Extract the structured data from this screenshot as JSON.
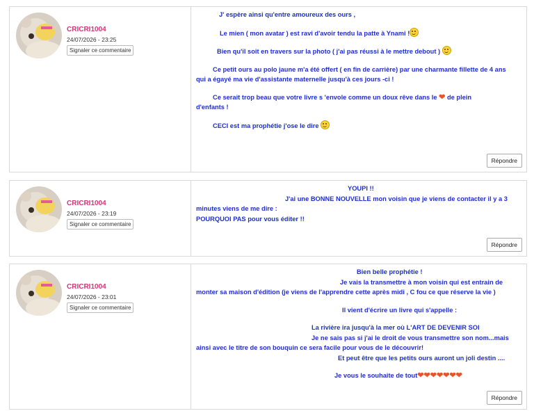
{
  "comments": [
    {
      "username": "CRICRI1004",
      "date": "24/07/2026 - 23:25",
      "report_label": "Signaler ce commentaire",
      "reply_label": "Répondre",
      "lines": [
        "J' espère  ainsi qu'entre amoureux des ours ,",
        "Le mien ( mon avatar ) est ravi d'avoir tendu la patte à Ynami !",
        "Bien qu'il soit en travers sur la photo ( j'ai pas réussi à le mettre debout )",
        "Ce petit ours au polo jaune m'a été offert ( en fin de carrière) par une charmante fillette de 4 ans",
        "qui a égayé ma vie d'assistante maternelle  jusqu'à ces jours -ci !",
        "Ce serait trop beau  que votre livre  s 'envole comme un doux rêve dans le",
        "de plein",
        "d'enfants !",
        "CECI est ma prophétie  j'ose le dire"
      ]
    },
    {
      "username": "CRICRI1004",
      "date": "24/07/2026 - 23:19",
      "report_label": "Signaler ce commentaire",
      "reply_label": "Répondre",
      "lines": [
        "YOUPI !!",
        "J'ai une BONNE NOUVELLE  mon voisin que je viens de contacter il y a 3",
        "minutes viens de me dire :",
        "POURQUOI PAS pour vous éditer !!"
      ]
    },
    {
      "username": "CRICRI1004",
      "date": "24/07/2026 - 23:01",
      "report_label": "Signaler ce commentaire",
      "reply_label": "Répondre",
      "lines": [
        "Bien belle prophétie !",
        "Je vais la transmettre à mon voisin  qui est entrain de",
        "monter sa maison d'édition (je viens de l'apprendre cette après midi , C fou ce que réserve la vie )",
        "Il vient d'écrire un livre qui s'appelle :",
        "La rivière ira jusqu'à la mer où L'ART DE DEVENIR SOI",
        "Je ne sais pas si j'ai le droit de vous transmettre son nom...mais",
        "ainsi avec le titre de son bouquin ce sera facile pour vous de le découvrir!",
        "Et peut être que les petits ours auront un joli destin ....",
        "Je vous le souhaite de tout"
      ]
    }
  ],
  "icons": {
    "smiley": "smiley-icon",
    "heart": "heart-icon",
    "heart_color": "#e8542a",
    "avatar": "teddy-bear-avatar"
  },
  "colors": {
    "username": "#d6337a",
    "comment_text": "#1f2fcf",
    "border": "#d9d9d9"
  }
}
